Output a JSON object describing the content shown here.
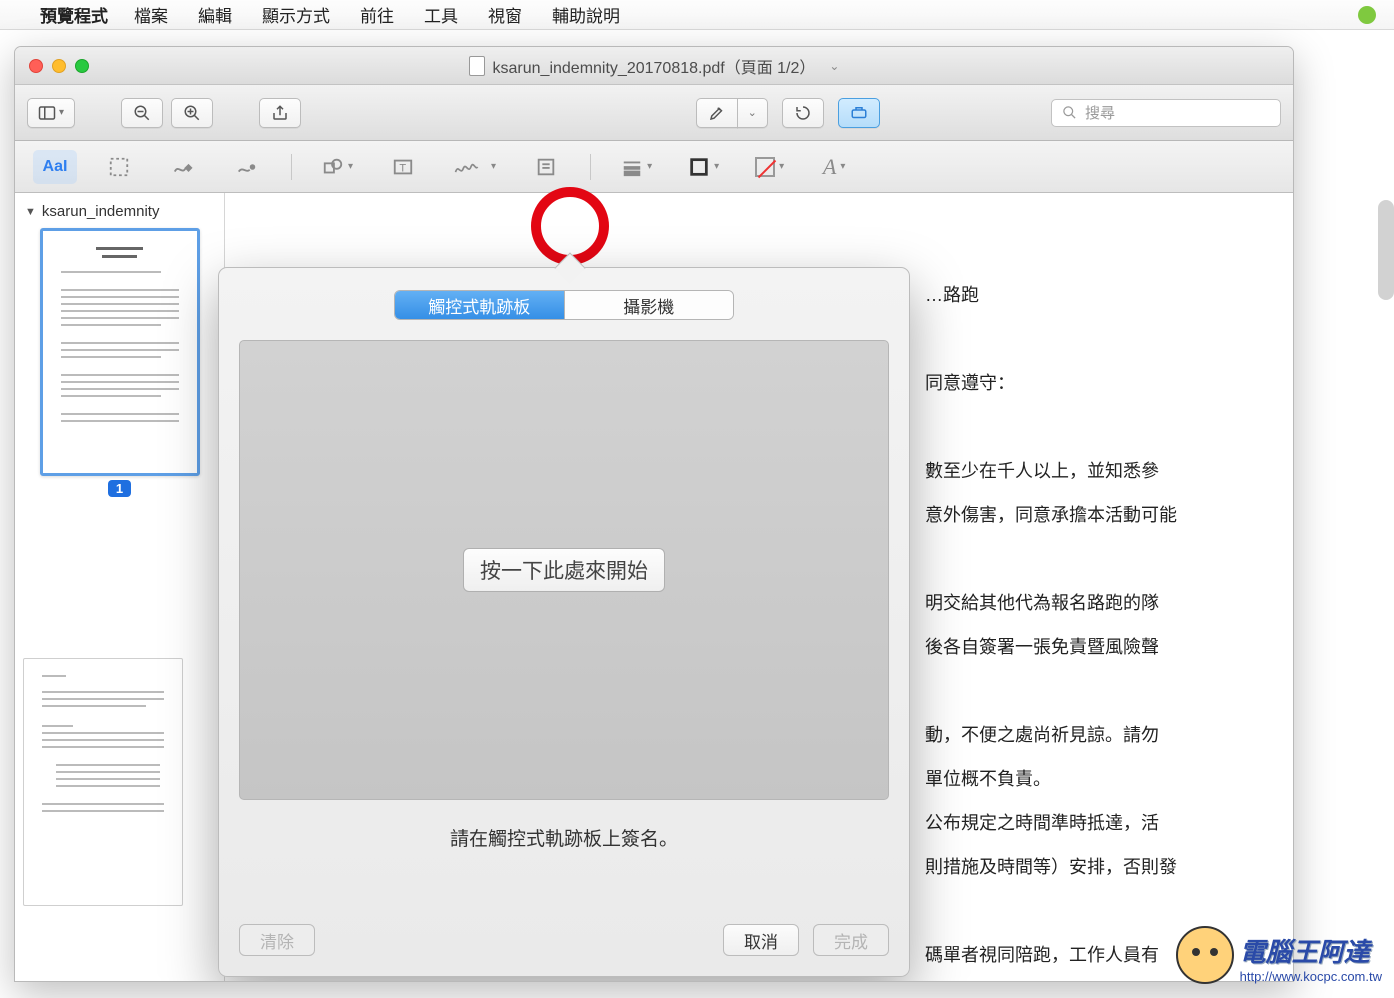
{
  "menubar": {
    "app_name": "預覽程式",
    "items": [
      "檔案",
      "編輯",
      "顯示方式",
      "前往",
      "工具",
      "視窗",
      "輔助說明"
    ]
  },
  "window": {
    "title": "ksarun_indemnity_20170818.pdf（頁面 1/2）"
  },
  "toolbar": {
    "search_placeholder": "搜尋"
  },
  "markup": {
    "text_select_label": "AaI"
  },
  "sidebar": {
    "doc_name": "ksarun_indemnity",
    "page_badge": "1"
  },
  "popover": {
    "tabs": {
      "trackpad": "觸控式軌跡板",
      "camera": "攝影機"
    },
    "start_button": "按一下此處來開始",
    "hint": "請在觸控式軌跡板上簽名。",
    "clear": "清除",
    "cancel": "取消",
    "done": "完成"
  },
  "document": {
    "lines": [
      "…路跑",
      "",
      "同意遵守：",
      "",
      "數至少在千人以上，並知悉參",
      "意外傷害，同意承擔本活動可能",
      "",
      "明交給其他代為報名路跑的隊",
      "後各自簽署一張免責暨風險聲",
      "",
      "動，不便之處尚祈見諒。請勿",
      "單位概不負責。",
      "公布規定之時間準時抵達，活",
      "則措施及時間等）安排，否則發",
      "",
      "碼單者視同陪跑，工作人員有"
    ]
  },
  "watermark": {
    "title": "電腦王阿達",
    "url": "http://www.kocpc.com.tw"
  }
}
